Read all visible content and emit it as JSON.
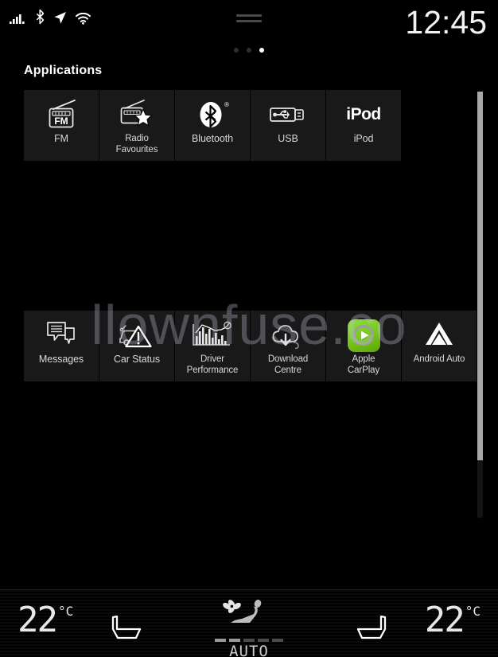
{
  "status_bar": {
    "icons": [
      {
        "name": "signal-bars-icon",
        "label": "signal-bars"
      },
      {
        "name": "bluetooth-icon",
        "label": "bluetooth"
      },
      {
        "name": "location-arrow-icon",
        "label": "location"
      },
      {
        "name": "wifi-icon",
        "label": "wifi"
      }
    ],
    "clock": "12:45",
    "page_dots": {
      "count": 3,
      "active_index": 2
    },
    "handle_bars": 2
  },
  "section": {
    "title": "Applications"
  },
  "apps": {
    "row1": [
      {
        "label": "FM",
        "icon": "fm-radio-icon",
        "multiline": false
      },
      {
        "label": "Radio\nFavourites",
        "icon": "radio-favourites-icon",
        "multiline": true
      },
      {
        "label": "Bluetooth",
        "icon": "bluetooth-app-icon",
        "multiline": false
      },
      {
        "label": "USB",
        "icon": "usb-icon",
        "multiline": false
      },
      {
        "label": "iPod",
        "icon": "ipod-icon",
        "multiline": false,
        "icon_text": "iPod"
      }
    ],
    "row2": [
      {
        "label": "Messages",
        "icon": "messages-icon",
        "multiline": false
      },
      {
        "label": "Car Status",
        "icon": "car-status-icon",
        "multiline": false
      },
      {
        "label": "Driver\nPerformance",
        "icon": "driver-performance-icon",
        "multiline": true
      },
      {
        "label": "Download\nCentre",
        "icon": "download-centre-icon",
        "multiline": true
      },
      {
        "label": "Apple\nCarPlay",
        "icon": "apple-carplay-icon",
        "multiline": true
      },
      {
        "label": "Android Auto",
        "icon": "android-auto-icon",
        "multiline": false
      }
    ]
  },
  "climate": {
    "left_temp": {
      "value": "22",
      "unit": "°C"
    },
    "right_temp": {
      "value": "22",
      "unit": "°C"
    },
    "left_seat_icon": "driver-seat-icon",
    "right_seat_icon": "passenger-seat-icon",
    "auto_label": "AUTO",
    "auto_icon": "auto-climate-seat-fan-icon",
    "auto_dashes": {
      "total": 5,
      "lit": 2
    }
  },
  "scrollbar": {
    "name": "vertical-scrollbar",
    "thumb_position": "top"
  },
  "watermark": {
    "text": "llownfuse.co"
  },
  "colors": {
    "background": "#000000",
    "tile": "#191919",
    "text": "#d8d8d8",
    "accent_green": "#7ccb23",
    "scrollbar": "#a8a8a8"
  }
}
